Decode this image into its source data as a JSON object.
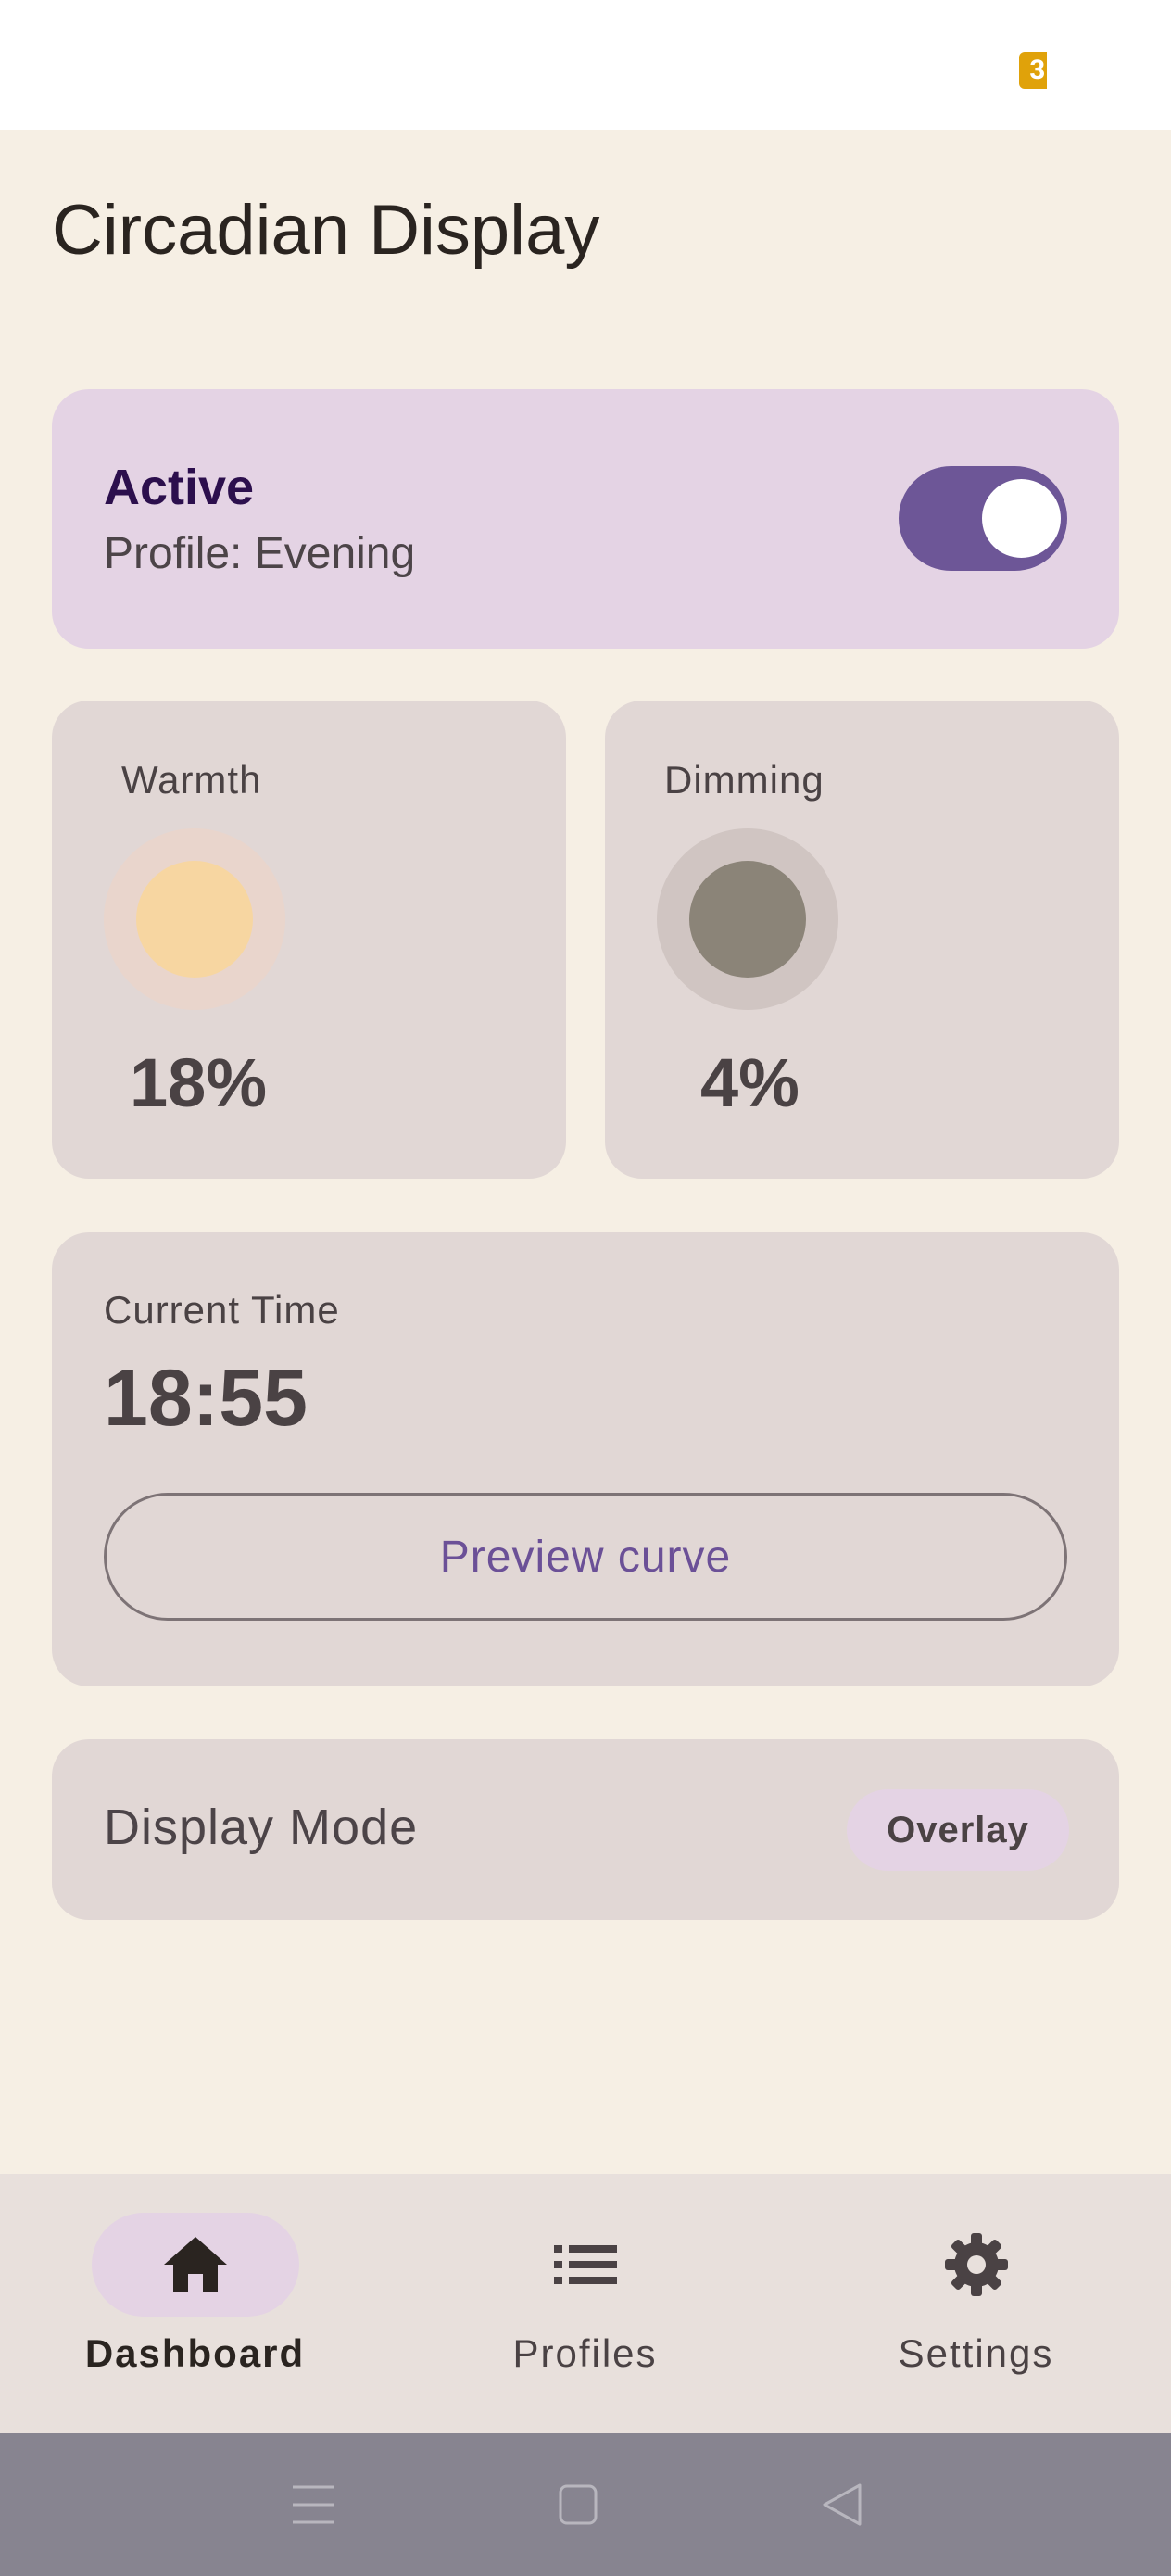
{
  "status_bar": {
    "battery_text": "3"
  },
  "app": {
    "title": "Circadian Display"
  },
  "active_card": {
    "title": "Active",
    "profile": "Profile: Evening",
    "toggle_on": true
  },
  "warmth": {
    "label": "Warmth",
    "value": "18%",
    "color": "#f7d6a1"
  },
  "dimming": {
    "label": "Dimming",
    "value": "4%",
    "color": "#8b8478"
  },
  "time_card": {
    "label": "Current Time",
    "time": "18:55",
    "preview_button": "Preview curve"
  },
  "display_mode": {
    "label": "Display Mode",
    "value": "Overlay"
  },
  "bottom_nav": {
    "items": [
      {
        "label": "Dashboard",
        "icon": "home-icon",
        "active": true
      },
      {
        "label": "Profiles",
        "icon": "list-icon",
        "active": false
      },
      {
        "label": "Settings",
        "icon": "gear-icon",
        "active": false
      }
    ]
  },
  "system_nav": {
    "icons": [
      "menu-icon",
      "home-square-icon",
      "back-icon"
    ]
  },
  "colors": {
    "accent": "#6d5697",
    "background": "#f6efe4",
    "card": "#e1d7d5",
    "active_card": "#e4d3e4"
  }
}
